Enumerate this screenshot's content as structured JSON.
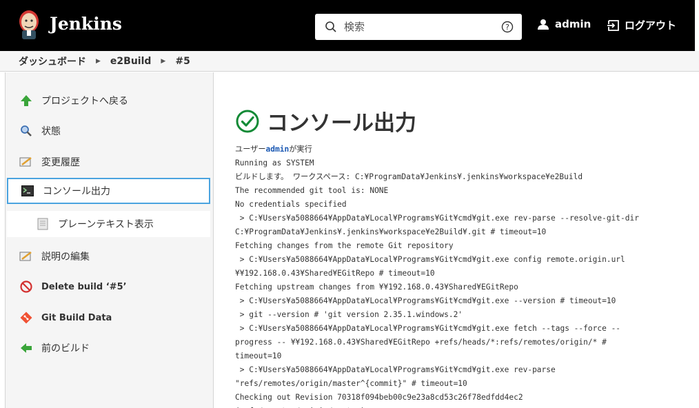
{
  "header": {
    "brand": "Jenkins",
    "search_placeholder": "検索",
    "user": "admin",
    "logout": "ログアウト"
  },
  "breadcrumb": [
    "ダッシュボード",
    "e2Build",
    "#5"
  ],
  "sidebar": {
    "items": [
      {
        "label": "プロジェクトへ戻る",
        "icon": "up-arrow-icon"
      },
      {
        "label": "状態",
        "icon": "magnifier-icon"
      },
      {
        "label": "変更履歴",
        "icon": "notepad-icon"
      },
      {
        "label": "コンソール出力",
        "icon": "terminal-icon"
      },
      {
        "label": "プレーンテキスト表示",
        "icon": "document-icon"
      },
      {
        "label": "説明の編集",
        "icon": "notepad-icon"
      },
      {
        "label": "Delete build ‘#5’",
        "icon": "no-entry-icon"
      },
      {
        "label": "Git Build Data",
        "icon": "git-icon"
      },
      {
        "label": "前のビルド",
        "icon": "left-arrow-icon"
      }
    ]
  },
  "main": {
    "title": "コンソール出力",
    "console_user_prefix": "ユーザー",
    "console_user": "admin",
    "console_user_suffix": "が実行",
    "console_lines": [
      "Running as SYSTEM",
      "ビルドします。 ワークスペース: C:¥ProgramData¥Jenkins¥.jenkins¥workspace¥e2Build",
      "The recommended git tool is: NONE",
      "No credentials specified",
      " > C:¥Users¥a5088664¥AppData¥Local¥Programs¥Git¥cmd¥git.exe rev-parse --resolve-git-dir",
      "C:¥ProgramData¥Jenkins¥.jenkins¥workspace¥e2Build¥.git # timeout=10",
      "Fetching changes from the remote Git repository",
      " > C:¥Users¥a5088664¥AppData¥Local¥Programs¥Git¥cmd¥git.exe config remote.origin.url",
      "¥¥192.168.0.43¥Shared¥EGitRepo # timeout=10",
      "Fetching upstream changes from ¥¥192.168.0.43¥Shared¥EGitRepo",
      " > C:¥Users¥a5088664¥AppData¥Local¥Programs¥Git¥cmd¥git.exe --version # timeout=10",
      " > git --version # 'git version 2.35.1.windows.2'",
      " > C:¥Users¥a5088664¥AppData¥Local¥Programs¥Git¥cmd¥git.exe fetch --tags --force --",
      "progress -- ¥¥192.168.0.43¥Shared¥EGitRepo +refs/heads/*:refs/remotes/origin/* #",
      "timeout=10",
      " > C:¥Users¥a5088664¥AppData¥Local¥Programs¥Git¥cmd¥git.exe rev-parse",
      "\"refs/remotes/origin/master^{commit}\" # timeout=10",
      "Checking out Revision 70318f094beb00c9e23a8cd53c26f78edfdd4ec2",
      "(refs/remotes/origin/master)"
    ]
  }
}
